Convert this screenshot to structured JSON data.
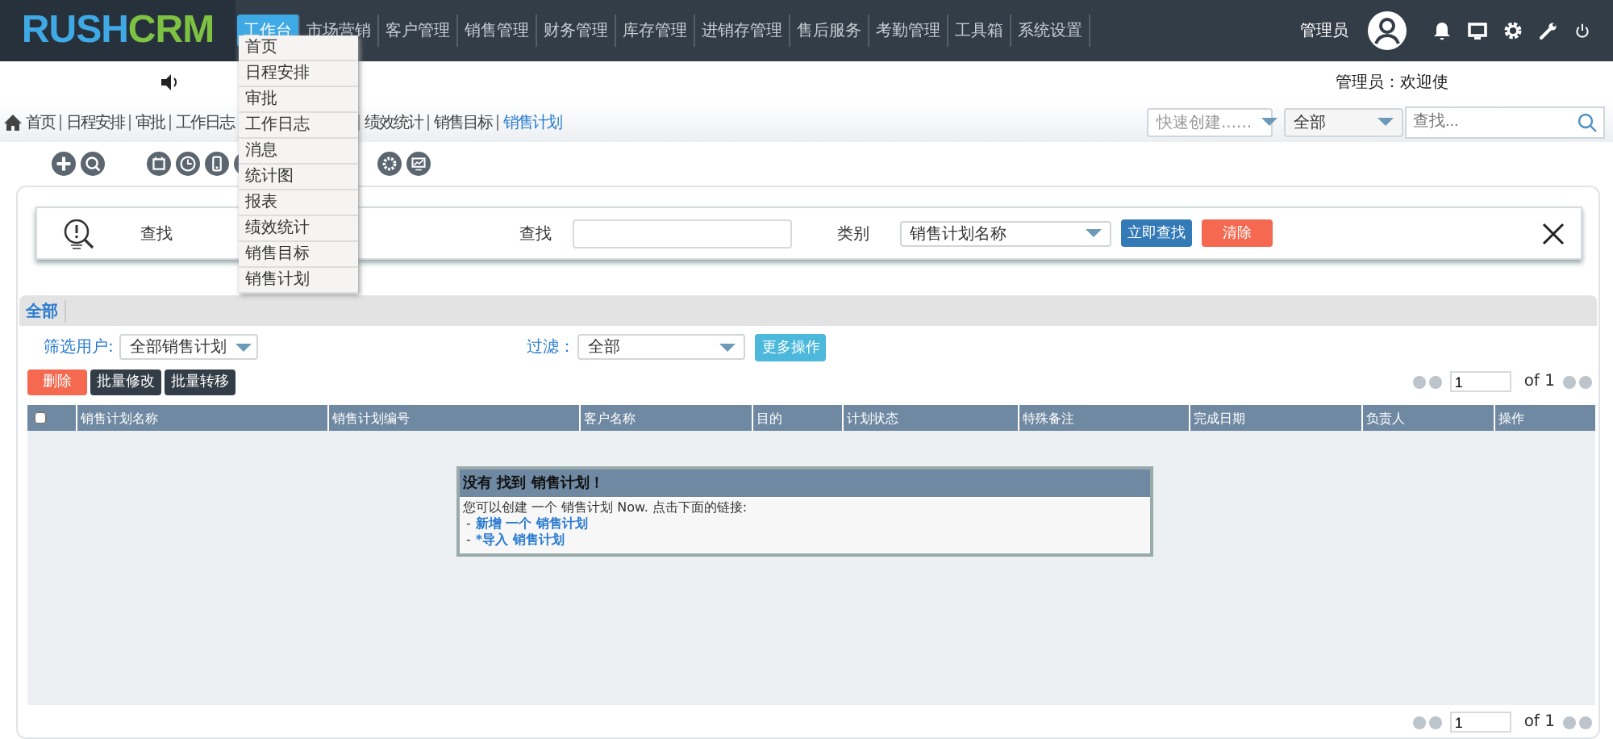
{
  "logo": {
    "part1": "RUSH",
    "part2": "CRM"
  },
  "nav": [
    {
      "label": "工作台",
      "selected": true
    },
    {
      "label": "市场营销",
      "selected": false
    },
    {
      "label": "客户管理",
      "selected": false
    },
    {
      "label": "销售管理",
      "selected": false
    },
    {
      "label": "财务管理",
      "selected": false
    },
    {
      "label": "库存管理",
      "selected": false
    },
    {
      "label": "进销存管理",
      "selected": false
    },
    {
      "label": "售后服务",
      "selected": false
    },
    {
      "label": "考勤管理",
      "selected": false
    },
    {
      "label": "工具箱",
      "selected": false
    },
    {
      "label": "系统设置",
      "selected": false
    }
  ],
  "nav_menu": [
    "首页",
    "日程安排",
    "审批",
    "工作日志",
    "消息",
    "统计图",
    "报表",
    "绩效统计",
    "销售目标",
    "销售计划"
  ],
  "user": {
    "name": "管理员",
    "welcome": "管理员：欢迎使"
  },
  "breadcrumb_left": [
    {
      "label": "首页",
      "selected": false
    },
    {
      "label": "日程安排",
      "selected": false
    },
    {
      "label": "审批",
      "selected": false
    },
    {
      "label": "工作日志",
      "selected": false
    }
  ],
  "breadcrumb_right": [
    {
      "label": "绩效统计",
      "selected": false
    },
    {
      "label": "销售目标",
      "selected": false
    },
    {
      "label": "销售计划",
      "selected": true
    }
  ],
  "quick_create": {
    "placeholder": "快速创建......"
  },
  "scope_select": {
    "value": "全部"
  },
  "global_search": {
    "placeholder": "查找..."
  },
  "search_panel": {
    "title": "查找",
    "field_label": "查找",
    "category_label": "类别",
    "category_value": "销售计划名称",
    "search_button": "立即查找",
    "clear_button": "清除"
  },
  "tabs": [
    {
      "label": "全部",
      "selected": true
    }
  ],
  "filters": {
    "user_label": "筛选用户:",
    "user_value": "全部销售计划",
    "filter_label": "过滤：",
    "filter_value": "全部",
    "more_button": "更多操作"
  },
  "actions": [
    {
      "label": "删除",
      "kind": "danger"
    },
    {
      "label": "批量修改",
      "kind": "dark"
    },
    {
      "label": "批量转移",
      "kind": "dark"
    }
  ],
  "pagination": {
    "page": "1",
    "of": "of 1"
  },
  "table": {
    "select_all": {
      "checked": false
    },
    "columns": [
      "销售计划名称",
      "销售计划编号",
      "客户名称",
      "目的",
      "计划状态",
      "特殊备注",
      "完成日期",
      "负责人",
      "操作"
    ]
  },
  "empty_message": {
    "title": "没有 找到 销售计划！",
    "text": "您可以创建 一个 销售计划 Now. 点击下面的链接:",
    "links": [
      {
        "prefix": "-",
        "label": "新增 一个 销售计划"
      },
      {
        "prefix": "-",
        "label": "*导入 销售计划"
      }
    ]
  },
  "pagination_bottom": {
    "page": "1",
    "of": "of 1"
  }
}
